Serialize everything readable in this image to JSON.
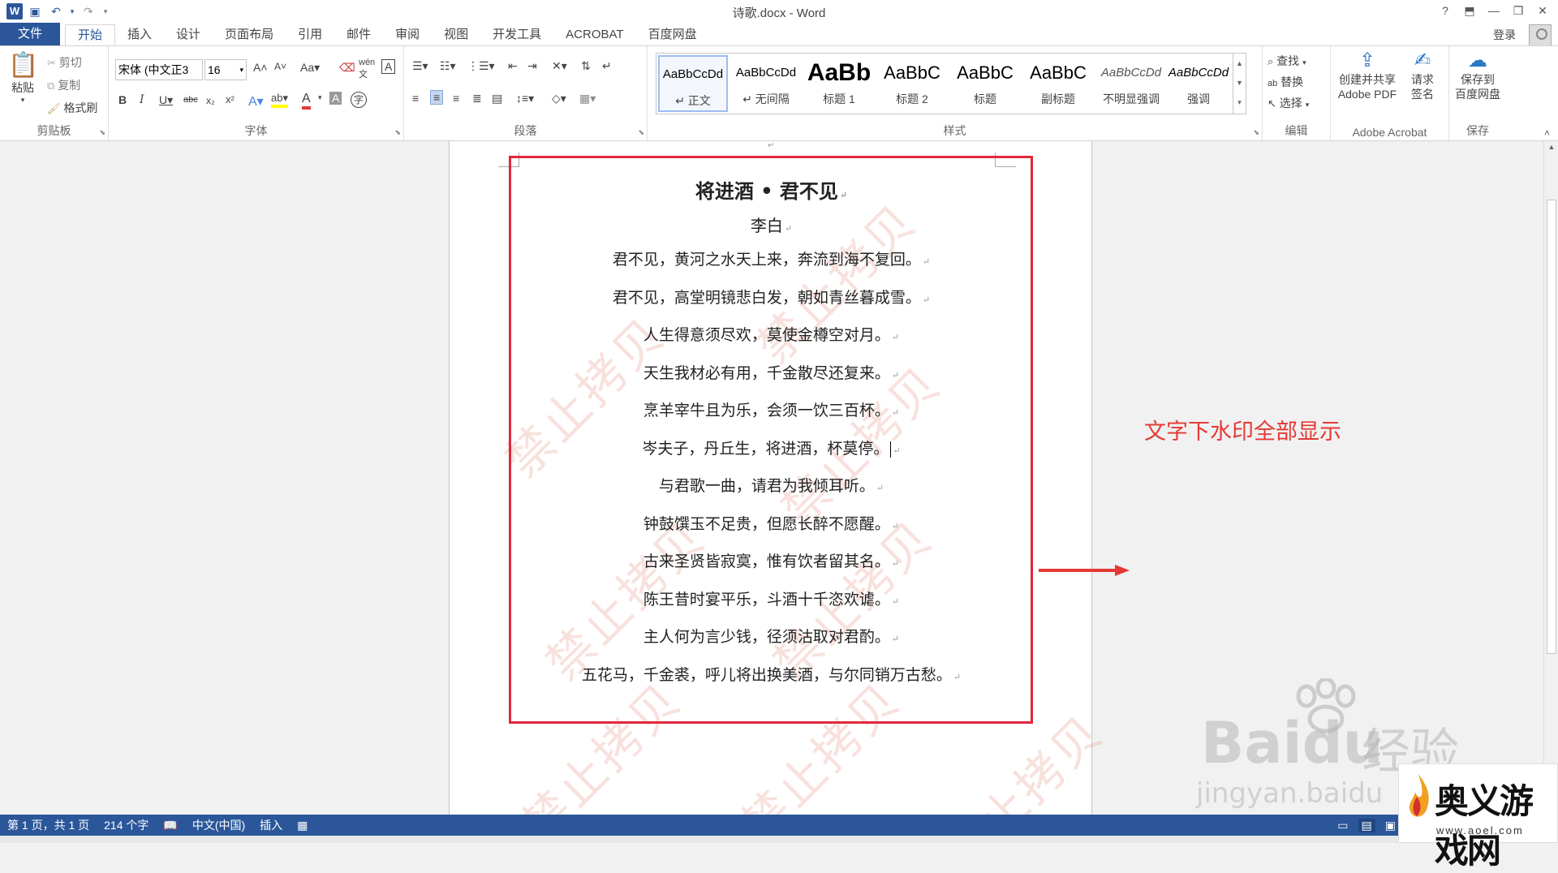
{
  "window": {
    "title": "诗歌.docx - Word"
  },
  "qat": {
    "undo": "↶",
    "redo": "↷"
  },
  "tabs": [
    "文件",
    "开始",
    "插入",
    "设计",
    "页面布局",
    "引用",
    "邮件",
    "审阅",
    "视图",
    "开发工具",
    "ACROBAT",
    "百度网盘"
  ],
  "active_tab": "开始",
  "account": {
    "login": "登录"
  },
  "ribbon": {
    "clipboard": {
      "label": "剪贴板",
      "paste": "粘贴",
      "cut": "剪切",
      "copy": "复制",
      "format_painter": "格式刷"
    },
    "font": {
      "label": "字体",
      "font_name": "宋体 (中文正3",
      "font_size": "16"
    },
    "paragraph": {
      "label": "段落"
    },
    "styles": {
      "label": "样式",
      "items": [
        {
          "sample": "AaBbCcDd",
          "name": "↵ 正文"
        },
        {
          "sample": "AaBbCcDd",
          "name": "↵ 无间隔"
        },
        {
          "sample": "AaBb",
          "name": "标题 1"
        },
        {
          "sample": "AaBbC",
          "name": "标题 2"
        },
        {
          "sample": "AaBbC",
          "name": "标题"
        },
        {
          "sample": "AaBbC",
          "name": "副标题"
        },
        {
          "sample": "AaBbCcDd",
          "name": "不明显强调"
        },
        {
          "sample": "AaBbCcDd",
          "name": "强调"
        }
      ]
    },
    "editing": {
      "label": "编辑",
      "find": "查找",
      "replace": "替换",
      "select": "选择"
    },
    "acrobat": {
      "label": "Adobe Acrobat",
      "create_pdf_line1": "创建并共享",
      "create_pdf_line2": "Adobe PDF",
      "sign_line1": "请求",
      "sign_line2": "签名"
    },
    "save": {
      "label": "保存",
      "baidu_line1": "保存到",
      "baidu_line2": "百度网盘"
    }
  },
  "document": {
    "title": "将进酒 • 君不见",
    "author": "李白",
    "lines": [
      "君不见，黄河之水天上来，奔流到海不复回。",
      "君不见，高堂明镜悲白发，朝如青丝暮成雪。",
      "人生得意须尽欢，莫使金樽空对月。",
      "天生我材必有用，千金散尽还复来。",
      "烹羊宰牛且为乐，会须一饮三百杯。",
      "岑夫子，丹丘生，将进酒，杯莫停。",
      "与君歌一曲，请君为我倾耳听。",
      "钟鼓馔玉不足贵，但愿长醉不愿醒。",
      "古来圣贤皆寂寞，惟有饮者留其名。",
      "陈王昔时宴平乐，斗酒十千恣欢谑。",
      "主人何为言少钱，径须沽取对君酌。",
      "五花马，千金裘，呼儿将出换美酒，与尔同销万古愁。"
    ],
    "watermark": "禁止拷贝",
    "paragraph_mark": "↵"
  },
  "annotation": {
    "text": "文字下水印全部显示",
    "color": "#e53935"
  },
  "statusbar": {
    "page": "第 1 页，共 1 页",
    "words": "214 个字",
    "language": "中文(中国)",
    "mode": "插入"
  },
  "overlay": {
    "baidu": "Baidu",
    "jingyan": "经验",
    "baidu_url": "jingyan.baidu",
    "site_name": "奥义游戏网",
    "site_url": "www.aoel.com"
  },
  "colors": {
    "accent": "#2b579a",
    "box": "#e0283c"
  }
}
